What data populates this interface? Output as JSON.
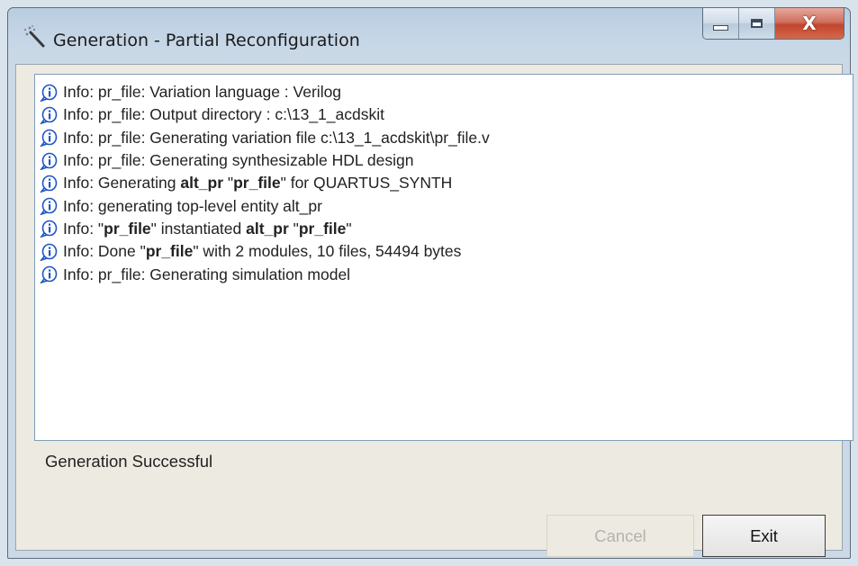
{
  "window": {
    "title": "Generation - Partial Reconfiguration",
    "icon": "magic-wand-icon",
    "controls": {
      "minimize": "minimize-icon",
      "maximize": "maximize-icon",
      "close_label": "X"
    }
  },
  "log": {
    "icon": "info-icon",
    "lines": [
      {
        "parts": [
          {
            "text": "Info: pr_file: Variation language : Verilog",
            "bold": false
          }
        ]
      },
      {
        "parts": [
          {
            "text": "Info: pr_file: Output directory : c:\\13_1_acdskit",
            "bold": false
          }
        ]
      },
      {
        "parts": [
          {
            "text": "Info: pr_file: Generating variation file c:\\13_1_acdskit\\pr_file.v",
            "bold": false
          }
        ]
      },
      {
        "parts": [
          {
            "text": "Info: pr_file: Generating synthesizable HDL design",
            "bold": false
          }
        ]
      },
      {
        "parts": [
          {
            "text": "Info: Generating ",
            "bold": false
          },
          {
            "text": "alt_pr",
            "bold": true
          },
          {
            "text": " \"",
            "bold": false
          },
          {
            "text": "pr_file",
            "bold": true
          },
          {
            "text": "\" for QUARTUS_SYNTH",
            "bold": false
          }
        ]
      },
      {
        "parts": [
          {
            "text": "Info: generating top-level entity alt_pr",
            "bold": false
          }
        ]
      },
      {
        "parts": [
          {
            "text": "Info: \"",
            "bold": false
          },
          {
            "text": "pr_file",
            "bold": true
          },
          {
            "text": "\" instantiated ",
            "bold": false
          },
          {
            "text": "alt_pr",
            "bold": true
          },
          {
            "text": " \"",
            "bold": false
          },
          {
            "text": "pr_file",
            "bold": true
          },
          {
            "text": "\"",
            "bold": false
          }
        ]
      },
      {
        "parts": [
          {
            "text": "Info: Done \"",
            "bold": false
          },
          {
            "text": "pr_file",
            "bold": true
          },
          {
            "text": "\" with 2 modules, 10 files, 54494 bytes",
            "bold": false
          }
        ]
      },
      {
        "parts": [
          {
            "text": "Info: pr_file: Generating simulation model",
            "bold": false
          }
        ]
      }
    ]
  },
  "status": {
    "text": "Generation Successful"
  },
  "buttons": {
    "cancel": {
      "label": "Cancel",
      "enabled": false
    },
    "exit": {
      "label": "Exit",
      "enabled": true
    }
  },
  "colors": {
    "info_icon": "#1f55c6",
    "close_button": "#c7442e"
  }
}
